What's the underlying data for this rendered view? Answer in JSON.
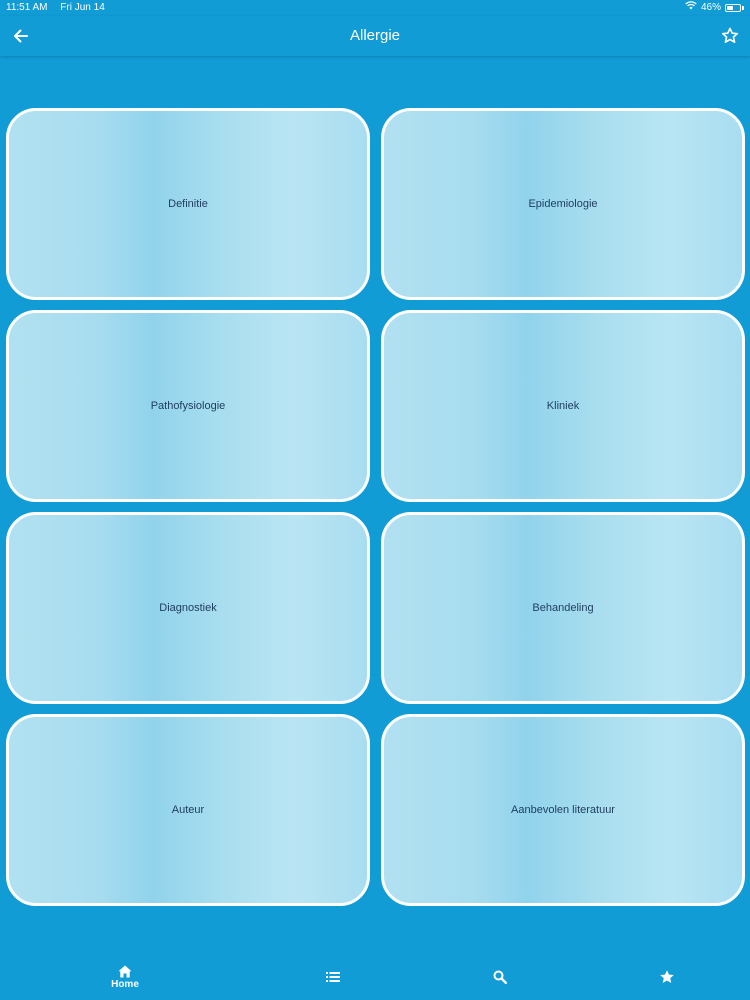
{
  "status_bar": {
    "time": "11:51 AM",
    "date": "Fri Jun 14",
    "battery_text": "46%",
    "battery_level": 0.46,
    "wifi_icon": "wifi-icon",
    "battery_icon": "battery-icon"
  },
  "header": {
    "title": "Allergie",
    "back_icon": "arrow-left-icon",
    "favorite_icon": "star-outline-icon"
  },
  "tiles": [
    {
      "label": "Definitie"
    },
    {
      "label": "Epidemiologie"
    },
    {
      "label": "Pathofysiologie"
    },
    {
      "label": "Kliniek"
    },
    {
      "label": "Diagnostiek"
    },
    {
      "label": "Behandeling"
    },
    {
      "label": "Auteur"
    },
    {
      "label": "Aanbevolen literatuur"
    }
  ],
  "tab_bar": {
    "items": [
      {
        "label": "Home",
        "icon": "home-icon",
        "active": true
      },
      {
        "label": "",
        "icon": "list-icon",
        "active": false
      },
      {
        "label": "",
        "icon": "search-icon",
        "active": false
      },
      {
        "label": "",
        "icon": "star-icon",
        "active": false
      }
    ]
  },
  "colors": {
    "background": "#119cd6",
    "tile_border": "#ffffff",
    "tile_text": "#1f3c5e",
    "header_text": "#ffffff"
  }
}
